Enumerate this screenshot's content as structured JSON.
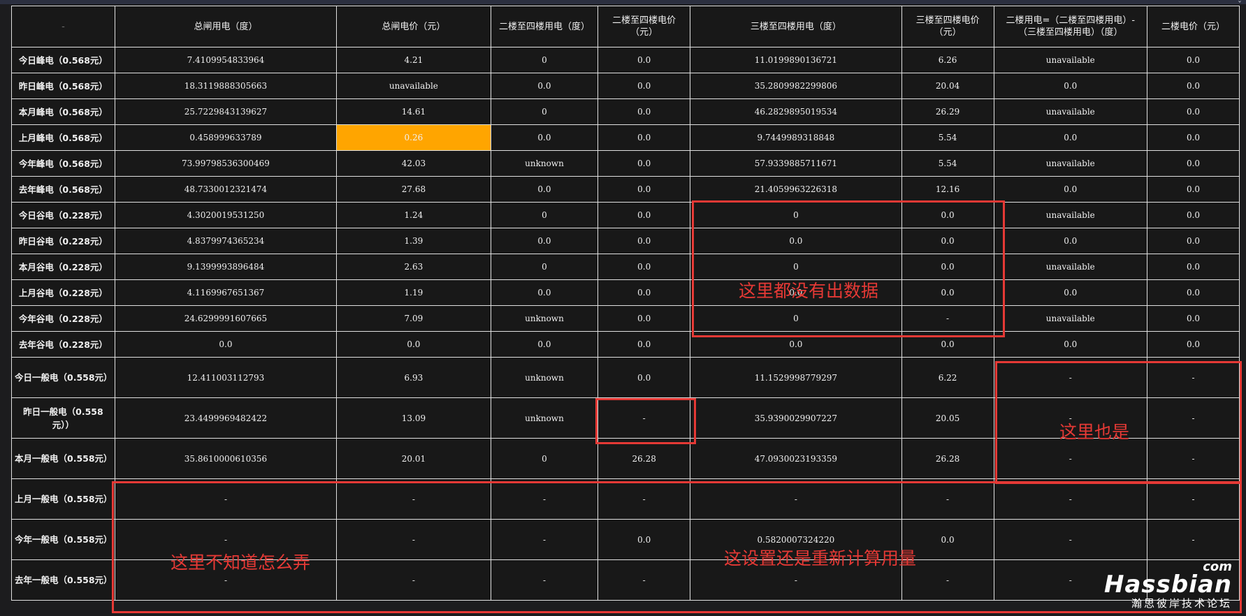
{
  "header": {
    "corner_glyph": "ˇ",
    "columns": [
      "-",
      "总闸用电（度）",
      "总闸电价（元）",
      "二楼至四楼用电（度）",
      "二楼至四楼电价（元）",
      "三楼至四楼用电（度）",
      "三楼至四楼电价（元）",
      "二楼用电=（二楼至四楼用电）-（三楼至四楼用电）（度）",
      "二楼电价（元）"
    ]
  },
  "rows": [
    {
      "label": "今日峰电（0.568元）",
      "cells": [
        "7.4109954833964",
        "4.21",
        "0",
        "0.0",
        "11.0199890136721",
        "6.26",
        "unavailable",
        "0.0"
      ]
    },
    {
      "label": "昨日峰电（0.568元）",
      "cells": [
        "18.3119888305663",
        "unavailable",
        "0.0",
        "0.0",
        "35.2809982299806",
        "20.04",
        "0.0",
        "0.0"
      ]
    },
    {
      "label": "本月峰电（0.568元）",
      "cells": [
        "25.7229843139627",
        "14.61",
        "0",
        "0.0",
        "46.2829895019534",
        "26.29",
        "unavailable",
        "0.0"
      ]
    },
    {
      "label": "上月峰电（0.568元）",
      "cells": [
        "0.458999633789",
        "0.26",
        "0.0",
        "0.0",
        "9.7449989318848",
        "5.54",
        "0.0",
        "0.0"
      ]
    },
    {
      "label": "今年峰电（0.568元）",
      "cells": [
        "73.99798536300469",
        "42.03",
        "unknown",
        "0.0",
        "57.9339885711671",
        "5.54",
        "unavailable",
        "0.0"
      ]
    },
    {
      "label": "去年峰电（0.568元）",
      "cells": [
        "48.7330012321474",
        "27.68",
        "0.0",
        "0.0",
        "21.4059963226318",
        "12.16",
        "0.0",
        "0.0"
      ]
    },
    {
      "label": "今日谷电（0.228元）",
      "cells": [
        "4.3020019531250",
        "1.24",
        "0",
        "0.0",
        "0",
        "0.0",
        "unavailable",
        "0.0"
      ]
    },
    {
      "label": "昨日谷电（0.228元）",
      "cells": [
        "4.8379974365234",
        "1.39",
        "0.0",
        "0.0",
        "0.0",
        "0.0",
        "0.0",
        "0.0"
      ]
    },
    {
      "label": "本月谷电（0.228元）",
      "cells": [
        "9.1399993896484",
        "2.63",
        "0",
        "0.0",
        "0",
        "0.0",
        "unavailable",
        "0.0"
      ]
    },
    {
      "label": "上月谷电（0.228元）",
      "cells": [
        "4.1169967651367",
        "1.19",
        "0.0",
        "0.0",
        "0.0",
        "0.0",
        "0.0",
        "0.0"
      ]
    },
    {
      "label": "今年谷电（0.228元）",
      "cells": [
        "24.6299991607665",
        "7.09",
        "unknown",
        "0.0",
        "0",
        "-",
        "unavailable",
        "0.0"
      ]
    },
    {
      "label": "去年谷电（0.228元）",
      "cells": [
        "0.0",
        "0.0",
        "0.0",
        "0.0",
        "0.0",
        "0.0",
        "0.0",
        "0.0"
      ]
    },
    {
      "label": "今日一般电（0.558元）",
      "cells": [
        "12.411003112793",
        "6.93",
        "unknown",
        "0.0",
        "11.1529998779297",
        "6.22",
        "-",
        "-"
      ]
    },
    {
      "label": "昨日一般电（0.558元））",
      "cells": [
        "23.4499969482422",
        "13.09",
        "unknown",
        "-",
        "35.9390029907227",
        "20.05",
        "-",
        "-"
      ]
    },
    {
      "label": "本月一般电（0.558元）",
      "cells": [
        "35.8610000610356",
        "20.01",
        "0",
        "26.28",
        "47.0930023193359",
        "26.28",
        "-",
        "-"
      ]
    },
    {
      "label": "上月一般电（0.558元）",
      "cells": [
        "-",
        "-",
        "-",
        "-",
        "-",
        "-",
        "-",
        "-"
      ]
    },
    {
      "label": "今年一般电（0.558元）",
      "cells": [
        "-",
        "-",
        "-",
        "0.0",
        "0.5820007324220",
        "0.0",
        "-",
        "-"
      ]
    },
    {
      "label": "去年一般电（0.558元）",
      "cells": [
        "-",
        "-",
        "-",
        "-",
        "-",
        "-",
        "-",
        "-"
      ]
    }
  ],
  "annotations": {
    "no_data": "这里都没有出数据",
    "here_too": "这里也是",
    "dont_know": "这里不知道怎么弄",
    "recalc": "这设置还是重新计算用量"
  },
  "watermark": {
    "com": "com",
    "brand": "Hassbian",
    "subtitle": "瀚思彼岸技术论坛"
  },
  "colors": {
    "highlight": "#ffa500",
    "annotation": "#e53935",
    "border": "#e0e0e0",
    "background": "#181818"
  }
}
